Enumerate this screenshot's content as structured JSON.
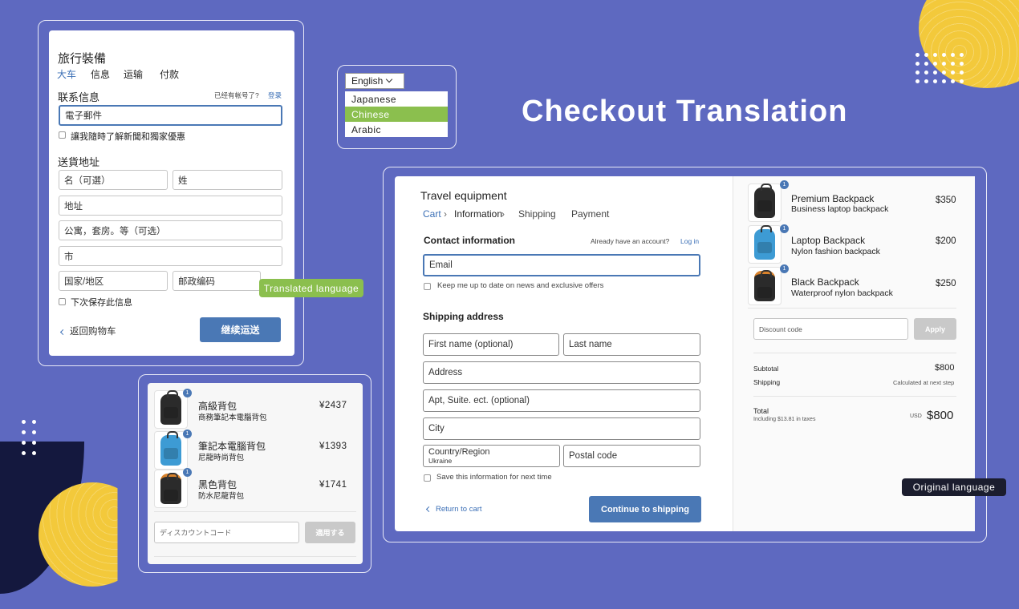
{
  "title": "Checkout Translation",
  "labels": {
    "translated": "Translated language",
    "original": "Original language"
  },
  "language_picker": {
    "selected": "English",
    "options": [
      "Japanese",
      "Chinese",
      "Arabic"
    ],
    "highlighted": "Chinese"
  },
  "translated_form": {
    "shop_title": "旅行裝備",
    "breadcrumb": [
      "大车",
      "信息",
      "运输",
      "付款"
    ],
    "contact_heading": "联系信息",
    "have_account": "已经有帐号了?",
    "login": "登录",
    "email_placeholder": "電子郵件",
    "news_checkbox": "讓我隨時了解新聞和獨家優惠",
    "shipping_heading": "送貨地址",
    "first_name": "名（可選）",
    "last_name": "姓",
    "address": "地址",
    "apt": "公寓，套房。等（可选）",
    "city": "市",
    "country": "国家/地区",
    "postal": "邮政编码",
    "save_checkbox": "下次保存此信息",
    "return": "返回购物车",
    "continue": "继续运送"
  },
  "translated_cart": {
    "items": [
      {
        "name": "高級背包",
        "desc": "商務筆記本電腦背包",
        "price": "¥2437",
        "qty": "1"
      },
      {
        "name": "筆記本電腦背包",
        "desc": "尼龍時尚背包",
        "price": "¥1393",
        "qty": "1"
      },
      {
        "name": "黑色背包",
        "desc": "防水尼龍背包",
        "price": "¥1741",
        "qty": "1"
      }
    ],
    "discount_placeholder": "ディスカウントコード",
    "apply": "適用する"
  },
  "original_form": {
    "shop_title": "Travel equipment",
    "breadcrumb": [
      "Cart",
      "Information",
      "Shipping",
      "Payment"
    ],
    "contact_heading": "Contact information",
    "have_account": "Already have an account?",
    "login": "Log in",
    "email_placeholder": "Email",
    "news_checkbox": "Keep me up to date on news and exclusive offers",
    "shipping_heading": "Shipping address",
    "first_name": "First name (optional)",
    "last_name": "Last name",
    "address": "Address",
    "apt": "Apt, Suite. ect. (optional)",
    "city": "City",
    "country_label": "Country/Region",
    "country_value": "Ukraine",
    "postal": "Postal code",
    "save_checkbox": "Save this information for next time",
    "return": "Return to cart",
    "continue": "Continue to shipping"
  },
  "original_cart": {
    "items": [
      {
        "name": "Premium Backpack",
        "desc": "Business laptop backpack",
        "price": "$350",
        "qty": "1"
      },
      {
        "name": "Laptop Backpack",
        "desc": "Nylon fashion backpack",
        "price": "$200",
        "qty": "1"
      },
      {
        "name": "Black Backpack",
        "desc": "Waterproof nylon backpack",
        "price": "$250",
        "qty": "1"
      }
    ],
    "discount_placeholder": "Discount code",
    "apply": "Apply",
    "subtotal_label": "Subtotal",
    "subtotal_value": "$800",
    "shipping_label": "Shipping",
    "shipping_value": "Calculated at next step",
    "total_label": "Total",
    "taxes_note": "Including $13.81 in taxes",
    "currency": "USD",
    "total_value": "$800"
  },
  "colors": {
    "background": "#5e69c0",
    "accent_blue": "#4a78b5",
    "green": "#8bbf4e",
    "yellow": "#f3c93b",
    "navy": "#14183e"
  }
}
